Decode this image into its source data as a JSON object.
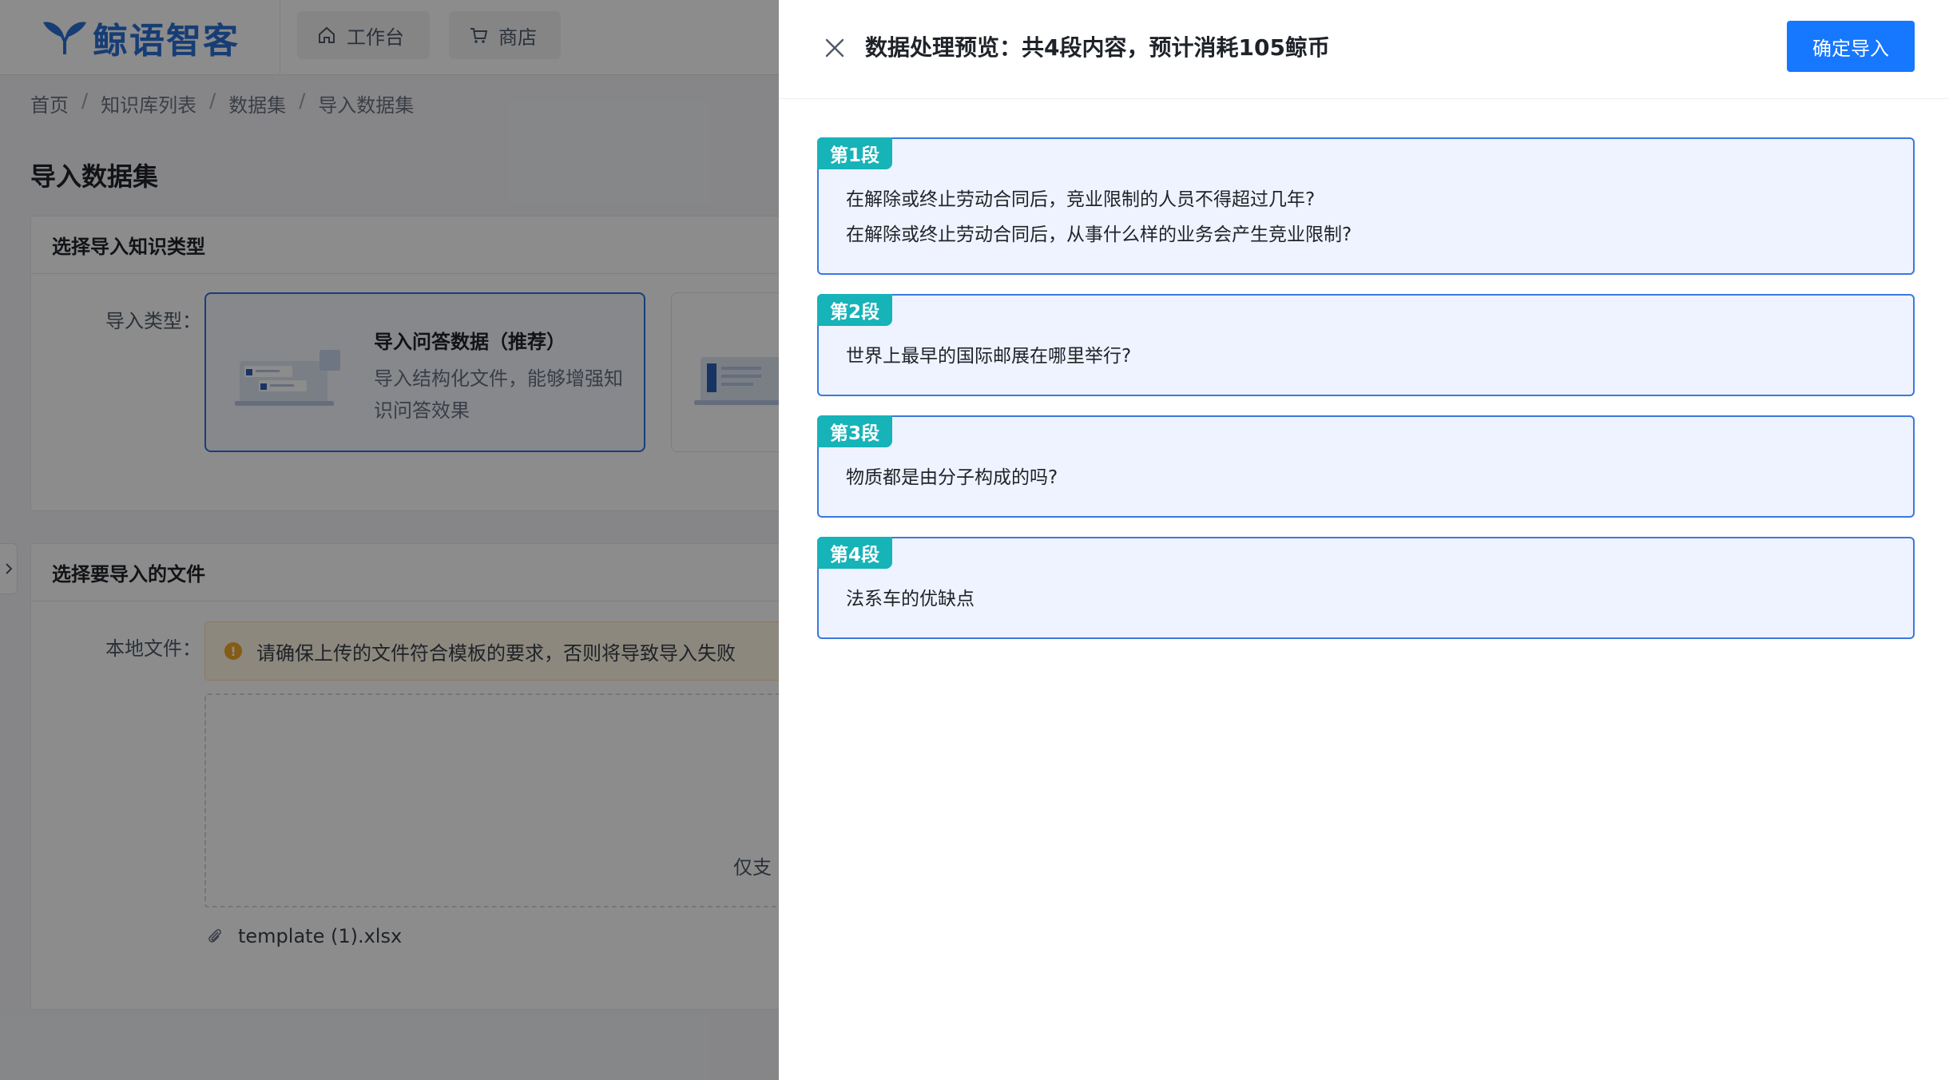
{
  "app": {
    "logo_text": "鲸语智客",
    "nav": {
      "workbench": "工作台",
      "shop": "商店"
    },
    "breadcrumb": [
      "首页",
      "知识库列表",
      "数据集",
      "导入数据集"
    ],
    "page_title": "导入数据集",
    "type_section": {
      "title": "选择导入知识类型",
      "field_label": "导入类型：",
      "option_qa": {
        "title": "导入问答数据（推荐）",
        "desc": "导入结构化文件，能够增强知识问答效果"
      }
    },
    "file_section": {
      "title": "选择要导入的文件",
      "field_label": "本地文件：",
      "warning": "请确保上传的文件符合模板的要求，否则将导致导入失败",
      "upload_tip": "仅支",
      "file_name": "template (1).xlsx"
    }
  },
  "drawer": {
    "title": "数据处理预览：共4段内容，预计消耗105鲸币",
    "confirm_label": "确定导入",
    "segments": [
      {
        "tag": "第1段",
        "lines": [
          "在解除或终止劳动合同后，竞业限制的人员不得超过几年?",
          "在解除或终止劳动合同后，从事什么样的业务会产生竞业限制?"
        ]
      },
      {
        "tag": "第2段",
        "lines": [
          "世界上最早的国际邮展在哪里举行?"
        ]
      },
      {
        "tag": "第3段",
        "lines": [
          "物质都是由分子构成的吗?"
        ]
      },
      {
        "tag": "第4段",
        "lines": [
          "法系车的优缺点"
        ]
      }
    ]
  },
  "colors": {
    "primary": "#1677ff",
    "segment_border": "#3a78e0",
    "segment_bg": "#eef3ff",
    "segment_tag": "#16b3b8",
    "warning": "#f5a623"
  }
}
